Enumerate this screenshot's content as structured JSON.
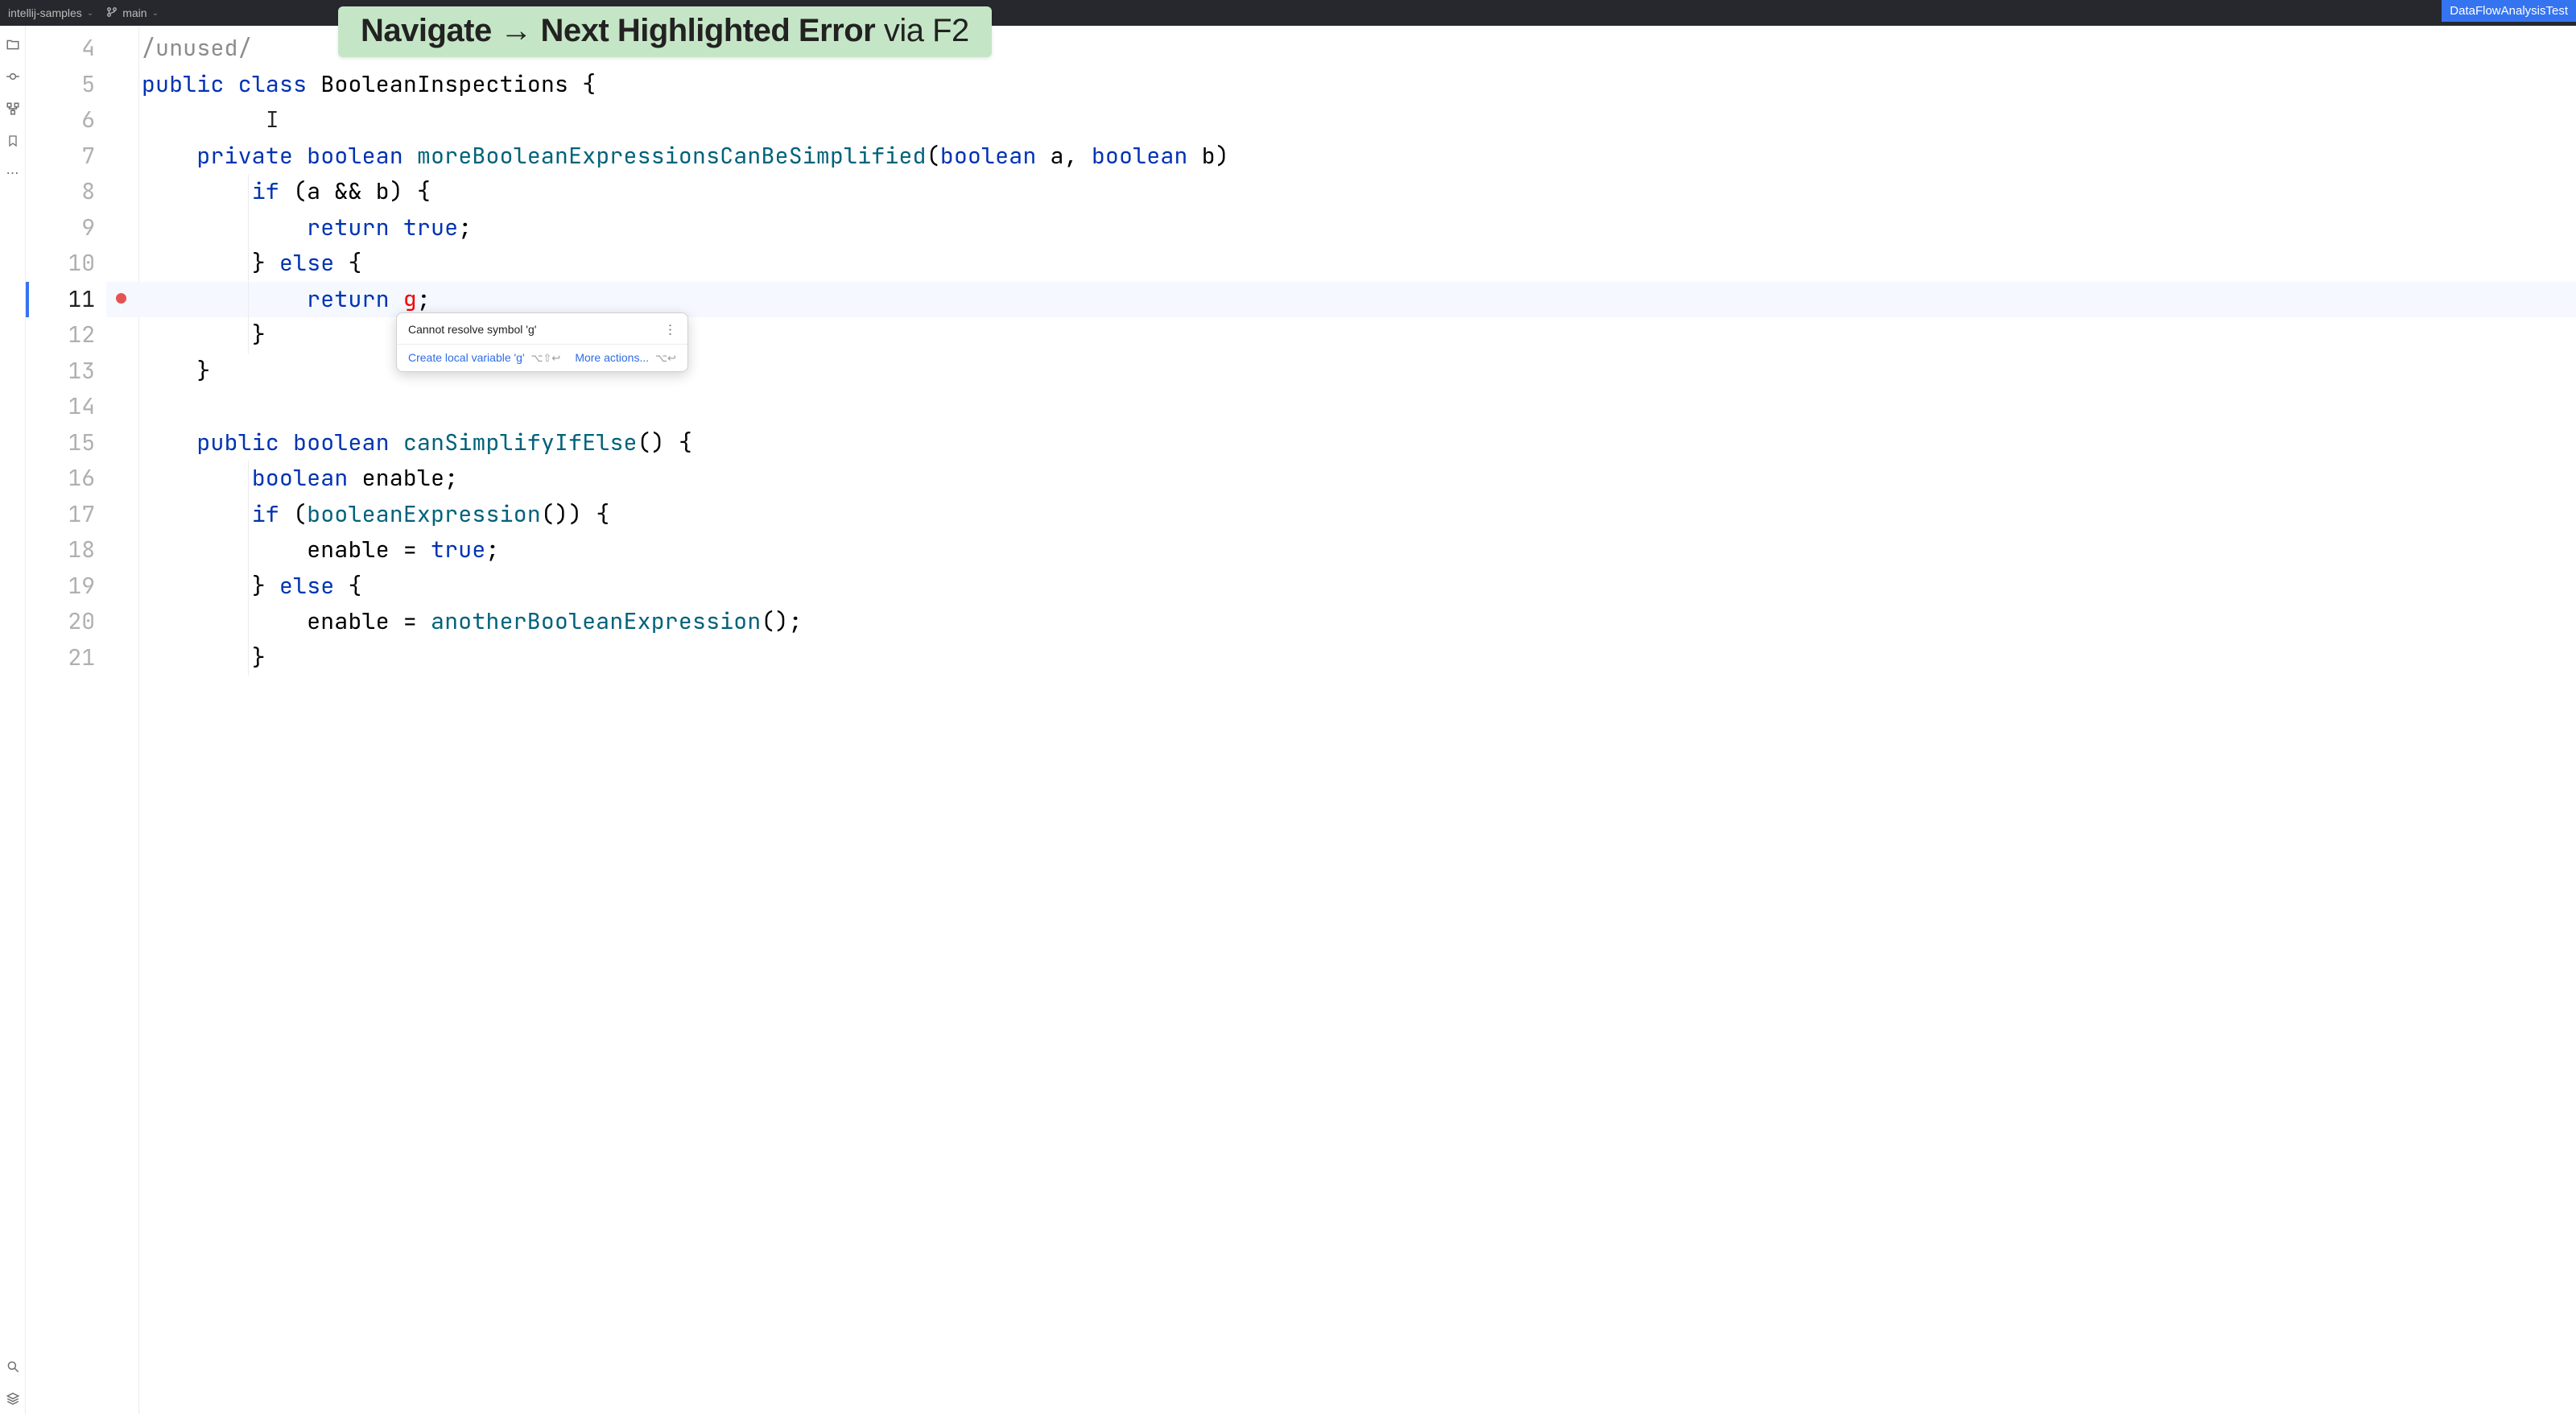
{
  "topbar": {
    "project": "intellij-samples",
    "branch": "main"
  },
  "badge": "DataFlowAnalysisTest",
  "tip": {
    "bold": "Navigate",
    "arrow": "→",
    "bold2": "Next Highlighted Error",
    "rest": " via F2"
  },
  "gutter": {
    "start": 4,
    "end": 21,
    "active": 11
  },
  "code": {
    "l4": {
      "cmt": "/unused/"
    },
    "l5": {
      "kw1": "public",
      "kw2": "class",
      "cls": "BooleanInspections",
      "brace": " {"
    },
    "l6": {
      "caret": "I"
    },
    "l7": {
      "kw1": "private",
      "kw2": "boolean",
      "mtd": "moreBooleanExpressionsCanBeSimplified",
      "params_open": "(",
      "kw3": "boolean",
      "p1": " a, ",
      "kw4": "boolean",
      "p2": " b) "
    },
    "l8": {
      "kw": "if",
      "cond": " (a && b) {"
    },
    "l9": {
      "kw": "return",
      "rest": " ",
      "kw2": "true",
      "semi": ";"
    },
    "l10": {
      "brace": "} ",
      "kw": "else",
      "brace2": " {"
    },
    "l11": {
      "kw": "return",
      "sp": " ",
      "err": "g",
      "semi": ";"
    },
    "l12": {
      "brace": "}"
    },
    "l13": {
      "brace": "}"
    },
    "l14": {},
    "l15": {
      "kw1": "public",
      "kw2": "boolean",
      "mtd": "canSimplifyIfElse",
      "rest": "() {"
    },
    "l16": {
      "kw": "boolean",
      "rest": " enable;"
    },
    "l17": {
      "kw": "if",
      "open": " (",
      "mtd": "booleanExpression",
      "rest": "()) {"
    },
    "l18": {
      "var": "enable = ",
      "kw": "true",
      "semi": ";"
    },
    "l19": {
      "brace": "} ",
      "kw": "else",
      "brace2": " {"
    },
    "l20": {
      "var": "enable = ",
      "mtd": "anotherBooleanExpression",
      "rest": "();"
    },
    "l21": {
      "brace": "}"
    }
  },
  "tooltip": {
    "title": "Cannot resolve symbol 'g'",
    "action1": "Create local variable 'g'",
    "shortcut1": "⌥⇧↩",
    "action2": "More actions...",
    "shortcut2": "⌥↩"
  }
}
